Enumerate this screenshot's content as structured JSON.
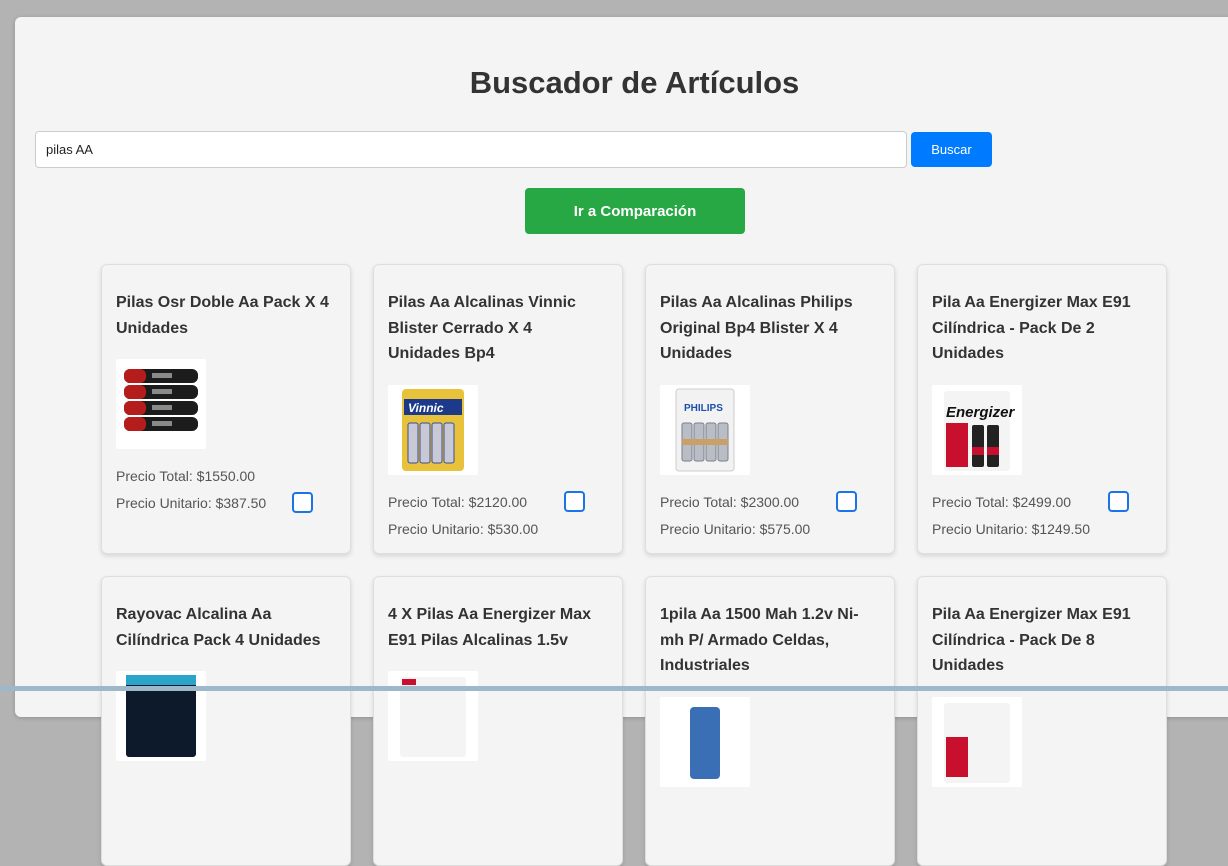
{
  "page": {
    "title": "Buscador de Artículos"
  },
  "search": {
    "value": "pilas AA",
    "button_label": "Buscar"
  },
  "compare_button_label": "Ir a Comparación",
  "products": [
    {
      "title": "Pilas Osr Doble Aa Pack X 4 Unidades",
      "price_total": "Precio Total: $1550.00",
      "price_unit": "Precio Unitario: $387.50",
      "image": "black-red-batteries-image"
    },
    {
      "title": "Pilas Aa Alcalinas Vinnic Blister Cerrado X 4 Unidades Bp4",
      "price_total": "Precio Total: $2120.00",
      "price_unit": "Precio Unitario: $530.00",
      "image": "vinnic-battery-pack-image",
      "brand": "Vinnic"
    },
    {
      "title": "Pilas Aa Alcalinas Philips Original Bp4 Blister X 4 Unidades",
      "price_total": "Precio Total: $2300.00",
      "price_unit": "Precio Unitario: $575.00",
      "image": "philips-battery-pack-image",
      "brand": "PHILIPS"
    },
    {
      "title": "Pila Aa Energizer Max E91 Cilíndrica - Pack De 2 Unidades",
      "price_total": "Precio Total: $2499.00",
      "price_unit": "Precio Unitario: $1249.50",
      "image": "energizer-battery-pack-image",
      "brand": "Energizer"
    },
    {
      "title": "Rayovac Alcalina Aa Cilíndrica Pack 4 Unidades",
      "image": "rayovac-battery-pack-image"
    },
    {
      "title": "4 X Pilas Aa Energizer Max E91 Pilas Alcalinas 1.5v",
      "image": "energizer-4-pack-image"
    },
    {
      "title": "1pila Aa 1500 Mah 1.2v Ni-mh P/ Armado Celdas, Industriales",
      "image": "rechargeable-cell-image"
    },
    {
      "title": "Pila Aa Energizer Max E91 Cilíndrica - Pack De 8 Unidades",
      "image": "energizer-8-pack-image"
    }
  ],
  "colors": {
    "primary": "#007bff",
    "success": "#28a745",
    "checkbox": "#1a73e8"
  }
}
